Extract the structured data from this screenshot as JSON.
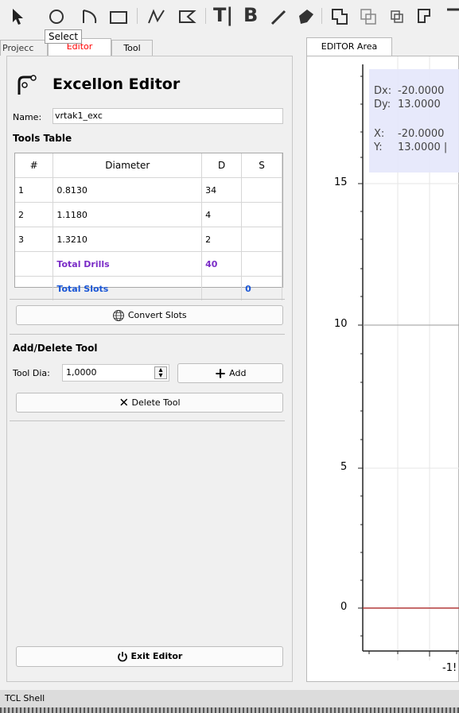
{
  "toolbar": {
    "tooltip": "Select",
    "text_tool": "T|",
    "bold_tool": "B"
  },
  "tabs": {
    "project": "Projecc",
    "editor": "Editor",
    "tool": "Tool"
  },
  "left": {
    "title": "Excellon Editor",
    "name_label": "Name:",
    "name_value": "vrtak1_exc",
    "tools_table_label": "Tools Table",
    "headers": [
      "#",
      "Diameter",
      "D",
      "S"
    ],
    "rows": [
      {
        "num": "1",
        "dia": "0.8130",
        "d": "34",
        "s": ""
      },
      {
        "num": "2",
        "dia": "1.1180",
        "d": "4",
        "s": ""
      },
      {
        "num": "3",
        "dia": "1.3210",
        "d": "2",
        "s": ""
      }
    ],
    "total_drills_label": "Total Drills",
    "total_drills_value": "40",
    "total_slots_label": "Total Slots",
    "total_slots_value": "0",
    "convert_slots": "Convert Slots",
    "add_delete_label": "Add/Delete Tool",
    "tool_dia_label": "Tool Dia:",
    "tool_dia_value": "1,0000",
    "add_button": "Add",
    "delete_button": "Delete Tool",
    "exit_button": "Exit Editor"
  },
  "editor": {
    "tab_label": "EDITOR Area",
    "dx_label": "Dx:",
    "dx_value": "-20.0000",
    "dy_label": "Dy:",
    "dy_value": "13.0000",
    "x_label": "X:",
    "x_value": "-20.0000",
    "y_label": "Y:",
    "y_value": "13.0000 |",
    "y_ticks": [
      "15",
      "10",
      "5",
      "0"
    ],
    "x_tick": "-1!"
  },
  "status": {
    "tcl_shell": "TCL Shell"
  },
  "colors": {
    "editor_tab_text": "#ff0000",
    "total_drills": "#7b2cc7",
    "total_slots": "#1a56d6",
    "axis_red": "#b33a3a"
  }
}
